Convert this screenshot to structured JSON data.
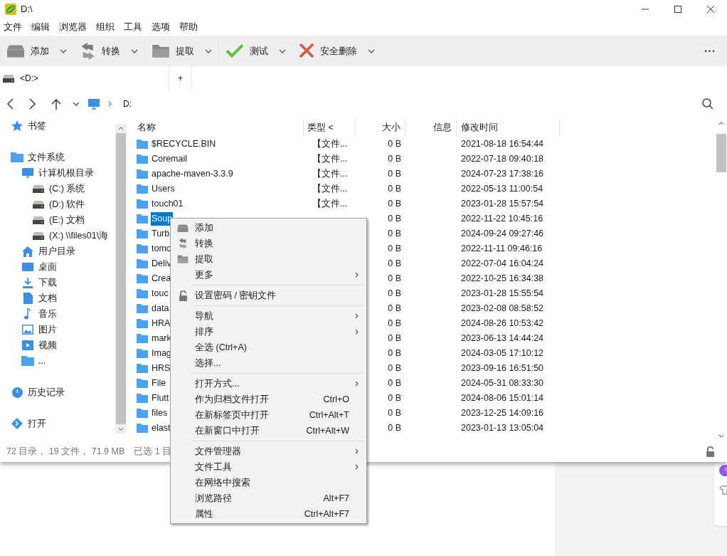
{
  "window": {
    "title": "D:\\"
  },
  "menu_bar": [
    "文件",
    "编辑",
    "浏览器",
    "组织",
    "工具",
    "选项",
    "帮助"
  ],
  "toolbar": [
    {
      "label": "添加",
      "kind": "add"
    },
    {
      "label": "转换",
      "kind": "convert"
    },
    {
      "label": "提取",
      "kind": "extract"
    },
    {
      "label": "测试",
      "kind": "test"
    },
    {
      "label": "安全删除",
      "kind": "delete"
    }
  ],
  "overflow_button": "···",
  "tabs": [
    {
      "label": "<D:>",
      "kind": "drive"
    },
    {
      "label": "+",
      "kind": "add"
    }
  ],
  "path": {
    "segments": [
      "D:"
    ]
  },
  "sidebar": {
    "items": [
      {
        "label": "书签",
        "kind": "star"
      },
      {
        "label": "文件系统",
        "kind": "folder",
        "children": [
          {
            "label": "计算机根目录",
            "kind": "monitor",
            "children": [
              {
                "label": "(C:) 系统",
                "kind": "drive"
              },
              {
                "label": "(D:) 软件",
                "kind": "drive"
              },
              {
                "label": "(E:) 文档",
                "kind": "drive"
              },
              {
                "label": "(X:) \\\\files01\\海",
                "kind": "drive"
              }
            ]
          },
          {
            "label": "用户目录",
            "kind": "home"
          },
          {
            "label": "桌面",
            "kind": "desktop"
          },
          {
            "label": "下载",
            "kind": "download"
          },
          {
            "label": "文档",
            "kind": "document"
          },
          {
            "label": "音乐",
            "kind": "music"
          },
          {
            "label": "图片",
            "kind": "image"
          },
          {
            "label": "视频",
            "kind": "video"
          },
          {
            "label": "...",
            "kind": "folder"
          }
        ]
      },
      {
        "label": "历史记录",
        "kind": "history"
      },
      {
        "label": "打开",
        "kind": "open"
      }
    ]
  },
  "table": {
    "columns": [
      "名称",
      "类型 <",
      "大小",
      "信息",
      "修改时间"
    ],
    "rows": [
      {
        "name": "$RECYCLE.BIN",
        "type": "【文件...",
        "size": "0 B",
        "modified": "2021-08-18 16:54:44",
        "selected": false
      },
      {
        "name": "Coremail",
        "type": "【文件...",
        "size": "0 B",
        "modified": "2022-07-18 09:40:18",
        "selected": false
      },
      {
        "name": "apache-maven-3.3.9",
        "type": "【文件...",
        "size": "0 B",
        "modified": "2024-07-23 17:38:16",
        "selected": false
      },
      {
        "name": "Users",
        "type": "【文件...",
        "size": "0 B",
        "modified": "2022-05-13 11:00:54",
        "selected": false
      },
      {
        "name": "touch01",
        "type": "【文件...",
        "size": "0 B",
        "modified": "2023-01-28 15:57:54",
        "selected": false
      },
      {
        "name": "Soup",
        "size": "0 B",
        "modified": "2022-11-22 10:45:16",
        "selected": true
      },
      {
        "name": "Turb",
        "size": "0 B",
        "modified": "2024-09-24 09:27:46",
        "selected": false
      },
      {
        "name": "tomc",
        "size": "0 B",
        "modified": "2022-11-11 09:46:16",
        "selected": false
      },
      {
        "name": "Deliv",
        "size": "0 B",
        "modified": "2022-07-04 16:04:24",
        "selected": false
      },
      {
        "name": "Crea",
        "size": "0 B",
        "modified": "2022-10-25 16:34:38",
        "selected": false
      },
      {
        "name": "touc",
        "size": "0 B",
        "modified": "2023-01-28 15:55:54",
        "selected": false
      },
      {
        "name": "data",
        "size": "0 B",
        "modified": "2023-02-08 08:58:52",
        "selected": false
      },
      {
        "name": "HRA",
        "size": "0 B",
        "modified": "2024-08-26 10:53:42",
        "selected": false
      },
      {
        "name": "mark",
        "size": "0 B",
        "modified": "2023-06-13 14:44:24",
        "selected": false
      },
      {
        "name": "Imag",
        "size": "0 B",
        "modified": "2024-03-05 17:10:12",
        "selected": false
      },
      {
        "name": "HRS",
        "size": "0 B",
        "modified": "2023-09-16 16:51:50",
        "selected": false
      },
      {
        "name": "File",
        "size": "0 B",
        "modified": "2024-05-31 08:33:30",
        "selected": false
      },
      {
        "name": "Flutt",
        "size": "0 B",
        "modified": "2024-08-06 15:01:14",
        "selected": false
      },
      {
        "name": "files",
        "size": "0 B",
        "modified": "2023-12-25 14:09:16",
        "selected": false
      },
      {
        "name": "elast",
        "size": "0 B",
        "modified": "2023-01-13 13:05:04",
        "selected": false
      }
    ]
  },
  "status_bar": {
    "summary": "72 目录， 19 文件， 71.9 MB",
    "selection": "已选 1 目"
  },
  "context_menu": {
    "groups": [
      [
        {
          "label": "添加",
          "kind": "add"
        },
        {
          "label": "转换",
          "kind": "convert"
        },
        {
          "label": "提取",
          "kind": "extract"
        },
        {
          "label": "更多",
          "submenu": true
        }
      ],
      [
        {
          "label": "设置密码 / 密钥文件",
          "kind": "lock"
        }
      ],
      [
        {
          "label": "导航",
          "submenu": true
        },
        {
          "label": "排序",
          "submenu": true
        },
        {
          "label": "全选 (Ctrl+A)"
        },
        {
          "label": "选择..."
        }
      ],
      [
        {
          "label": "打开方式...",
          "submenu": true
        },
        {
          "label": "作为归档文件打开",
          "shortcut": "Ctrl+O"
        },
        {
          "label": "在新标签页中打开",
          "shortcut": "Ctrl+Alt+T"
        },
        {
          "label": "在新窗口中打开",
          "shortcut": "Ctrl+Alt+W"
        }
      ],
      [
        {
          "label": "文件管理器",
          "submenu": true
        },
        {
          "label": "文件工具",
          "submenu": true
        },
        {
          "label": "在网络中搜索"
        },
        {
          "label": "浏览路径",
          "shortcut": "Alt+F7"
        },
        {
          "label": "属性",
          "shortcut": "Ctrl+Alt+F7"
        }
      ]
    ]
  }
}
